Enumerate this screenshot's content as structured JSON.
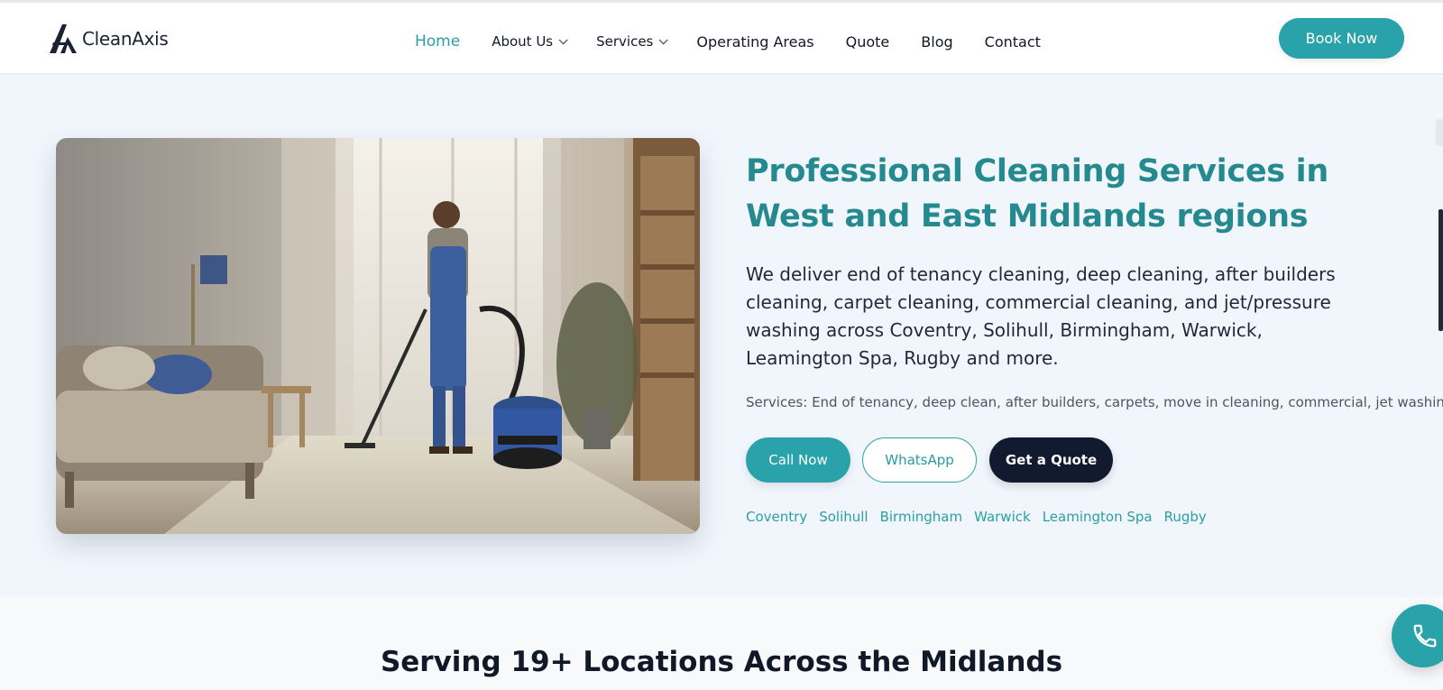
{
  "brand": {
    "name": "CleanAxis"
  },
  "nav": {
    "items": [
      {
        "label": "Home",
        "active": true,
        "dropdown": false
      },
      {
        "label": "About Us",
        "active": false,
        "dropdown": true
      },
      {
        "label": "Services",
        "active": false,
        "dropdown": true
      },
      {
        "label": "Operating Areas",
        "active": false,
        "dropdown": false
      },
      {
        "label": "Quote",
        "active": false,
        "dropdown": false
      },
      {
        "label": "Blog",
        "active": false,
        "dropdown": false
      },
      {
        "label": "Contact",
        "active": false,
        "dropdown": false
      }
    ],
    "cta": "Book Now"
  },
  "hero": {
    "title_lines": [
      "Professional Cleaning Services in",
      "West and East Midlands regions"
    ],
    "description_lines": [
      "We deliver end of tenancy cleaning, deep cleaning, after builders",
      "cleaning, carpet cleaning, commercial cleaning, and jet/pressure",
      "washing across Coventry, Solihull, Birmingham, Warwick,",
      "Leamington Spa, Rugby and more."
    ],
    "services_line": "Services: End of tenancy, deep clean, after builders, carpets, move in cleaning, commercial, jet washing.",
    "buttons": {
      "call": "Call Now",
      "whatsapp": "WhatsApp",
      "quote": "Get a Quote"
    },
    "areas": [
      "Coventry",
      "Solihull",
      "Birmingham",
      "Warwick",
      "Leamington Spa",
      "Rugby"
    ]
  },
  "locations": {
    "title": "Serving 19+ Locations Across the Midlands"
  },
  "colors": {
    "accent": "#2aa2aa",
    "heading": "#258a8f",
    "dark": "#111a2e",
    "hero_bg": "#f1f6fd"
  },
  "icons": {
    "phone_fab": "phone-icon",
    "logo": "logo-icon",
    "dropdown": "chevron-down-icon"
  }
}
